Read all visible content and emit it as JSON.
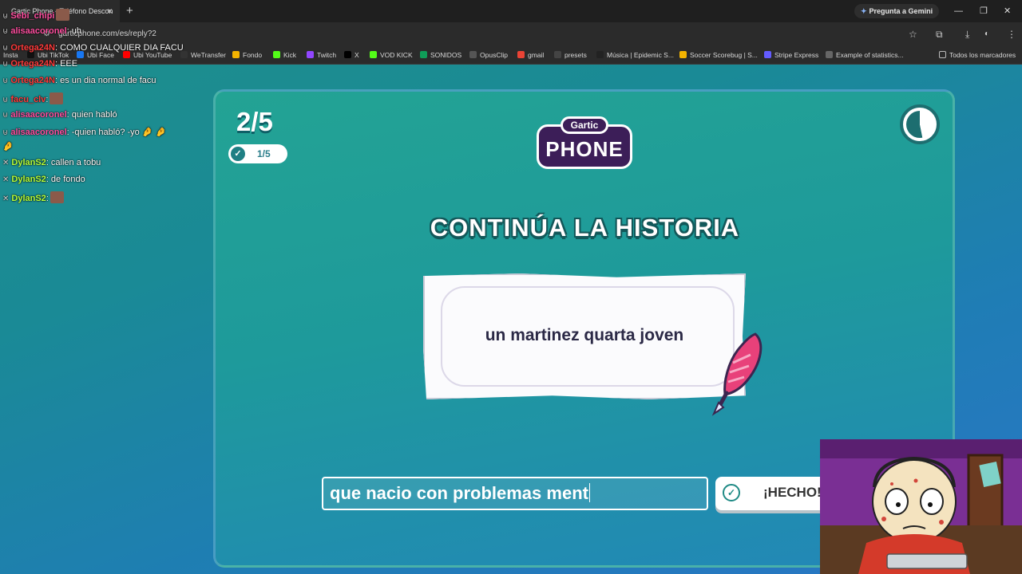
{
  "browser": {
    "tab_title": "Gartic Phone - Teléfono Descon",
    "tab_close": "×",
    "new_tab": "+",
    "gemini_label": "Pregunta a Gemini",
    "url": "garticphone.com/es/reply?2",
    "window_controls": [
      "—",
      "❐",
      "✕"
    ],
    "toolbar_icons": [
      "star-icon",
      "extensions-icon",
      "download-icon",
      "profile-icon",
      "menu-icon"
    ],
    "bookmarks": [
      {
        "label": "Insta",
        "color": "#d6249f"
      },
      {
        "label": "Ubi TikTok",
        "color": "#111111"
      },
      {
        "label": "Ubi Face",
        "color": "#1877f2"
      },
      {
        "label": "Ubi YouTube",
        "color": "#ff0000"
      },
      {
        "label": "WeTransfer",
        "color": "#333333"
      },
      {
        "label": "Fondo",
        "color": "#f4b400"
      },
      {
        "label": "Kick",
        "color": "#53fc18"
      },
      {
        "label": "Twitch",
        "color": "#9146ff"
      },
      {
        "label": "X",
        "color": "#000000"
      },
      {
        "label": "VOD KICK",
        "color": "#53fc18"
      },
      {
        "label": "SONIDOS",
        "color": "#0f9d58"
      },
      {
        "label": "OpusClip",
        "color": "#555555"
      },
      {
        "label": "gmail",
        "color": "#ea4335"
      },
      {
        "label": "presets",
        "color": "#444444"
      },
      {
        "label": "Música | Epidemic S...",
        "color": "#222222"
      },
      {
        "label": "Soccer Scorebug | S...",
        "color": "#f4b400"
      },
      {
        "label": "Stripe Express",
        "color": "#635bff"
      },
      {
        "label": "Example of statistics...",
        "color": "#666666"
      }
    ],
    "all_bookmarks": "Todos los marcadores"
  },
  "chat": [
    {
      "user": "Sebi_chipi",
      "color": "#ff4fa0",
      "message": "",
      "emote": true
    },
    {
      "user": "alisaacoronel",
      "color": "#ff4fa0",
      "message": ": uh",
      "emote": false
    },
    {
      "user": "Ortega24N",
      "color": "#ff3b3b",
      "message": ": COMO CUALQUIER DIA FACU",
      "emote": false
    },
    {
      "user": "Ortega24N",
      "color": "#ff3b3b",
      "message": ": EEE",
      "emote": false
    },
    {
      "user": "Ortega24N",
      "color": "#ff3b3b",
      "message": ": es un dia normal de facu",
      "emote": false
    },
    {
      "user": "facu_clv",
      "color": "#ff3b3b",
      "message": ":",
      "emote": true
    },
    {
      "user": "alisaacoronel",
      "color": "#ff4fa0",
      "message": ": quien habló",
      "emote": false
    },
    {
      "user": "alisaacoronel",
      "color": "#ff4fa0",
      "message": ": -quien habló? -yo 🤌 🤌",
      "emote": false
    },
    {
      "user": "",
      "color": "#ffffff",
      "message": "🤌",
      "emote": false
    },
    {
      "user": "DylanS2",
      "color": "#b6ff3a",
      "message": ": callen a tobu",
      "emote": false
    },
    {
      "user": "DylanS2",
      "color": "#b6ff3a",
      "message": ": de fondo",
      "emote": false
    },
    {
      "user": "DylanS2",
      "color": "#b6ff3a",
      "message": ":",
      "emote": true
    }
  ],
  "game": {
    "round": "2/5",
    "players_done": "1/5",
    "logo_top": "Gartic",
    "logo_bottom": "PHONE",
    "headline": "CONTINÚA LA HISTORIA",
    "prompt": "un martinez quarta joven",
    "answer_value": "que nacio con problemas ment",
    "done_label": "¡HECHO!",
    "timer_fraction_elapsed": 0.53,
    "accent_color": "#1f8a85",
    "logo_color": "#3c1e58"
  }
}
